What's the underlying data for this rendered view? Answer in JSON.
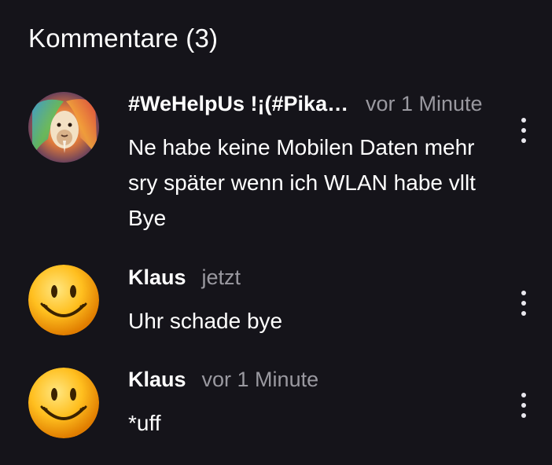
{
  "header": {
    "title": "Kommentare (3)"
  },
  "comments": [
    {
      "author": "#WeHelpUs !¡(#Pikachu",
      "time": "vor 1 Minute",
      "text": "Ne habe keine Mobilen Daten mehr sry später wenn ich WLAN habe vllt Bye",
      "avatar": "lion-avatar"
    },
    {
      "author": "Klaus",
      "time": "jetzt",
      "text": "Uhr schade bye",
      "avatar": "smiley-avatar"
    },
    {
      "author": "Klaus",
      "time": "vor 1 Minute",
      "text": "*uff",
      "avatar": "smiley-avatar"
    }
  ],
  "icons": {
    "more": "more-vertical-icon"
  },
  "colors": {
    "background": "#15141a",
    "text": "#ffffff",
    "muted": "#9a99a0"
  }
}
